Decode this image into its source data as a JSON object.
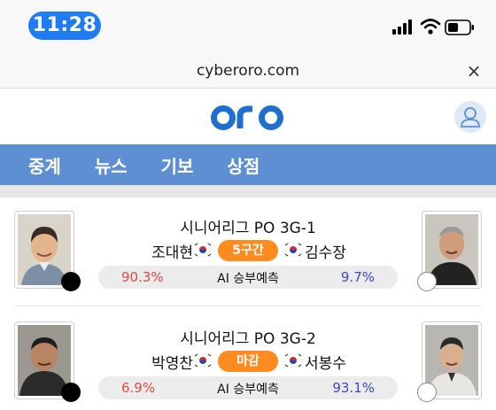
{
  "status_bar": {
    "time": "11:28",
    "icons": [
      "cellular-signal-icon",
      "wifi-icon",
      "battery-icon"
    ]
  },
  "browser": {
    "url": "cyberoro.com",
    "close_symbol": "×"
  },
  "site": {
    "logo_text": "oro",
    "brand_color": "#1f6fd1"
  },
  "nav": {
    "items": [
      {
        "label": "중계"
      },
      {
        "label": "뉴스"
      },
      {
        "label": "기보"
      },
      {
        "label": "상점"
      }
    ],
    "background": "#5f8fd3"
  },
  "matches": [
    {
      "title": "시니어리그 PO 3G-1",
      "black_player": "조대현",
      "white_player": "김수장",
      "status": "5구간",
      "ai_label": "AI 승부예측",
      "black_pct": "90.3%",
      "white_pct": "9.7%"
    },
    {
      "title": "시니어리그 PO 3G-2",
      "black_player": "박영찬",
      "white_player": "서봉수",
      "status": "마감",
      "ai_label": "AI 승부예측",
      "black_pct": "6.9%",
      "white_pct": "93.1%"
    }
  ],
  "colors": {
    "status_pill": "#ff8b20",
    "black_pct": "#e04a3c",
    "white_pct": "#3b47c9",
    "time_pill": "#1f7cf5"
  }
}
